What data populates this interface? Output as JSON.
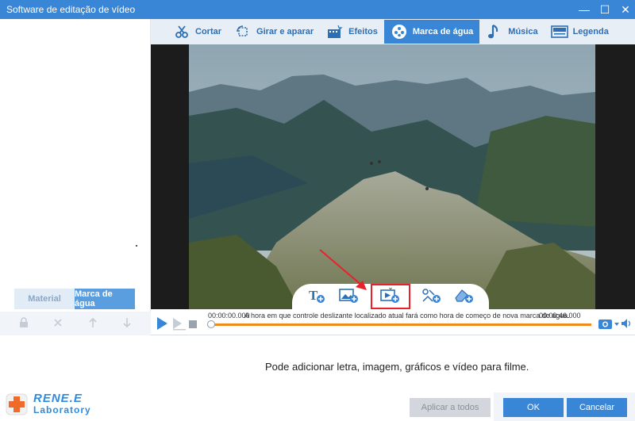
{
  "window": {
    "title": "Software de editação de vídeo",
    "minimize": "—",
    "maximize": "☐",
    "close": "✕"
  },
  "top_tabs": [
    {
      "label": "Cortar",
      "icon": "cut-icon"
    },
    {
      "label": "Girar e aparar",
      "icon": "rotate-crop-icon"
    },
    {
      "label": "Efeitos",
      "icon": "effects-icon"
    },
    {
      "label": "Marca de água",
      "icon": "watermark-icon",
      "active": true
    },
    {
      "label": "Música",
      "icon": "music-icon"
    },
    {
      "label": "Legenda",
      "icon": "subtitle-icon"
    }
  ],
  "left_panel": {
    "tabs": [
      {
        "label": "Material",
        "active": false
      },
      {
        "label": "Marca de água",
        "active": true
      }
    ],
    "tools": [
      "lock-icon",
      "delete-icon",
      "move-up-icon",
      "move-down-icon"
    ]
  },
  "watermark_tools": [
    "add-text-watermark",
    "add-image-watermark",
    "add-video-watermark",
    "add-graphic-watermark",
    "add-eraser-watermark"
  ],
  "timeline": {
    "start_time": "00:00:00.000",
    "hint": "A hora em que controle deslizante localizado atual fará como hora de começo de nova marca de água.",
    "end_time": "00:00:46.000"
  },
  "status_text": "Pode adicionar letra, imagem, gráficos e vídeo para filme.",
  "logo": {
    "line1": "RENE.E",
    "line2": "Laboratory"
  },
  "buttons": {
    "apply_all": "Aplicar a todos",
    "ok": "OK",
    "cancel": "Cancelar"
  },
  "colors": {
    "accent": "#3a86d6",
    "highlight": "#e8212a",
    "track": "#f08a1e"
  }
}
